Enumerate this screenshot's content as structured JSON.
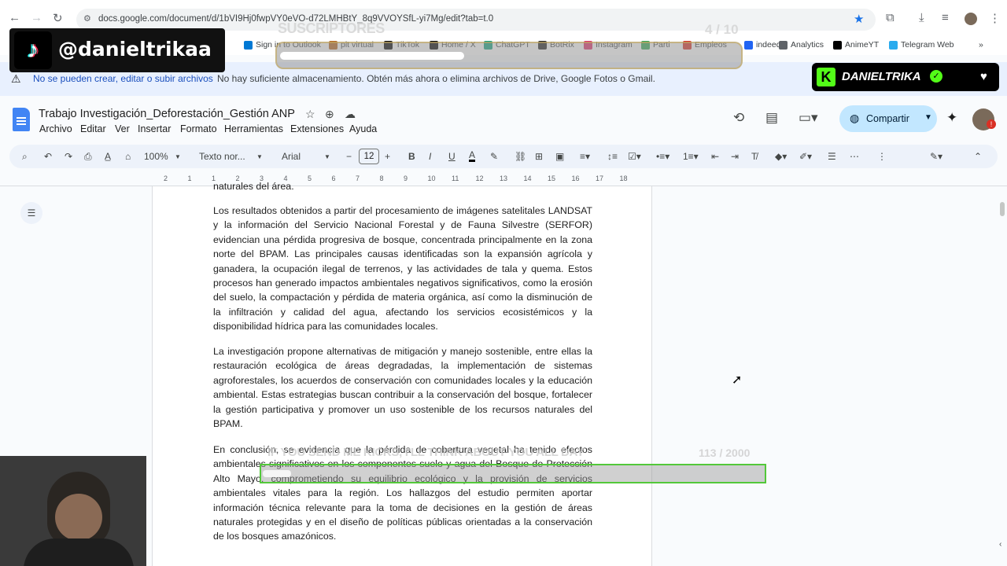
{
  "browser": {
    "url": "docs.google.com/document/d/1bVI9Hj0fwpVY0eVO-d72LMHBtY_8q9VVOYSfL-yi7Mg/edit?tab=t.0",
    "bookmarks": [
      {
        "label": "Sign in to Outlook",
        "color": "#0078d4"
      },
      {
        "label": "plt virtual",
        "color": "#b5651d"
      },
      {
        "label": "TikTok",
        "color": "#000000"
      },
      {
        "label": "Home / X",
        "color": "#000000"
      },
      {
        "label": "ChatGPT",
        "color": "#10a37f"
      },
      {
        "label": "BotRix",
        "color": "#222222"
      },
      {
        "label": "Instagram",
        "color": "#e1306c"
      },
      {
        "label": "Parti",
        "color": "#34a853"
      },
      {
        "label": "Empleos",
        "color": "#d93025"
      },
      {
        "label": "indeed",
        "color": "#2164f3"
      },
      {
        "label": "Analytics",
        "color": "#5f6368"
      },
      {
        "label": "AnimeYT",
        "color": "#000000"
      },
      {
        "label": "Telegram Web",
        "color": "#2aabee"
      }
    ]
  },
  "warning": {
    "title": "No se pueden crear, editar o subir archivos",
    "text": "No hay suficiente almacenamiento. Obtén más ahora o elimina archivos de Drive, Google Fotos o Gmail."
  },
  "doc": {
    "title": "Trabajo Investigación_Deforestación_Gestión ANP",
    "menus": [
      "Archivo",
      "Editar",
      "Ver",
      "Insertar",
      "Formato",
      "Herramientas",
      "Extensiones",
      "Ayuda"
    ],
    "share_label": "Compartir"
  },
  "toolbar": {
    "zoom": "100%",
    "style": "Texto nor...",
    "font": "Arial",
    "font_size": "12"
  },
  "ruler": [
    "2",
    "1",
    "1",
    "2",
    "3",
    "4",
    "5",
    "6",
    "7",
    "8",
    "9",
    "10",
    "11",
    "12",
    "13",
    "14",
    "15",
    "16",
    "17",
    "18"
  ],
  "content": {
    "partial_line": "naturales del área.",
    "p1": "Los resultados obtenidos a partir del procesamiento de imágenes satelitales LANDSAT y la información del Servicio Nacional Forestal y de Fauna Silvestre (SERFOR) evidencian una pérdida progresiva de bosque, concentrada principalmente en la zona norte del BPAM. Las principales causas identificadas son la expansión agrícola y ganadera, la ocupación ilegal de terrenos, y las actividades de tala y quema. Estos procesos han generado impactos ambientales negativos significativos, como la erosión del suelo, la compactación y pérdida de materia orgánica, así como la disminución de la infiltración y calidad del agua, afectando los servicios ecosistémicos y la disponibilidad hídrica para las comunidades locales.",
    "p2": "La investigación propone alternativas de mitigación y manejo sostenible, entre ellas la restauración ecológica de áreas degradadas, la implementación de sistemas agroforestales, los acuerdos de conservación con comunidades locales y la educación ambiental. Estas estrategias buscan contribuir a la conservación del bosque, fortalecer la gestión participativa y promover un uso sostenible de los recursos naturales del BPAM.",
    "p3": "En conclusión, se evidencia que la pérdida de cobertura vegetal ha tenido efectos ambientales significativos en los componentes suelo y agua del Bosque de Protección Alto Mayo, comprometiendo su equilibrio ecológico y la provisión de servicios ambientales vitales para la región. Los hallazgos del estudio permiten aportar información técnica relevante para la toma de decisiones en la gestión de áreas naturales protegidas y en el diseño de políticas públicas orientadas a la conservación de los bosques amazónicos."
  },
  "overlays": {
    "tiktok_handle": "@danieltrikaa",
    "subs_label": "SUSCRIPTORES",
    "subs_count": "4 / 10",
    "subs_progress": 0.4,
    "kick_name": "DANIELTRIKA",
    "kicks_text": "IF YOU SEND ME KICKS, I'LL THINK ABOUT YOU ALL DAY",
    "kicks_count": "113 / 2000",
    "kicks_progress": 0.0565
  }
}
